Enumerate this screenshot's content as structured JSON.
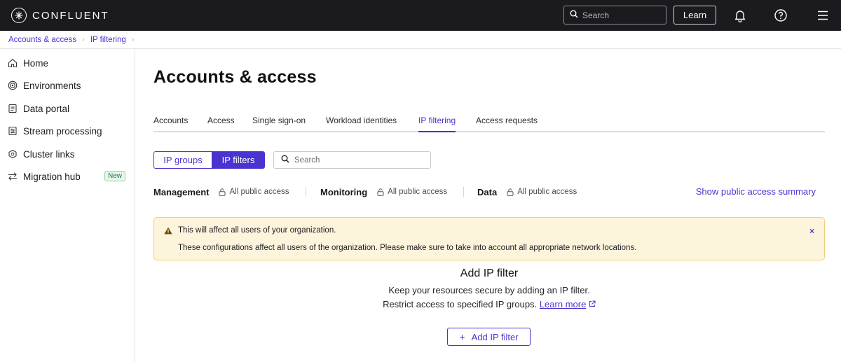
{
  "topbar": {
    "brand": "CONFLUENT",
    "search_placeholder": "Search",
    "learn_label": "Learn",
    "icons": [
      "bell-icon",
      "help-icon",
      "menu-icon"
    ]
  },
  "breadcrumb": [
    "Accounts & access",
    "IP filtering"
  ],
  "sidebar": {
    "items": [
      {
        "label": "Home",
        "icon": "home-icon"
      },
      {
        "label": "Environments",
        "icon": "environments-icon"
      },
      {
        "label": "Data portal",
        "icon": "data-portal-icon"
      },
      {
        "label": "Stream processing",
        "icon": "stream-processing-icon"
      },
      {
        "label": "Cluster links",
        "icon": "cluster-links-icon"
      },
      {
        "label": "Migration hub",
        "icon": "migration-hub-icon",
        "badge": "New"
      }
    ]
  },
  "main": {
    "title": "Accounts & access",
    "tabs": [
      {
        "label": "Accounts",
        "active": false
      },
      {
        "label": "Access",
        "active": false
      },
      {
        "label": "Single sign-on",
        "active": false
      },
      {
        "label": "Workload identities",
        "active": false
      },
      {
        "label": "IP filtering",
        "active": true
      },
      {
        "label": "Access requests",
        "active": false
      }
    ],
    "segments": {
      "left": "IP groups",
      "right": "IP filters",
      "selected": "IP filters"
    },
    "search_placeholder": "Search",
    "access": [
      {
        "label": "Management",
        "value": "All public access"
      },
      {
        "label": "Monitoring",
        "value": "All public access"
      },
      {
        "label": "Data",
        "value": "All public access"
      }
    ],
    "summary_link": "Show public access summary",
    "alert": {
      "title": "This will affect all users of your organization.",
      "body": "These configurations affect all users of the organization. Please make sure to take into account all appropriate network locations.",
      "close": "×"
    },
    "empty": {
      "title": "Add IP filter",
      "line1": "Keep your resources secure by adding an IP filter.",
      "line2": "Restrict access to specified IP groups.",
      "learn_more": "Learn more",
      "button": "Add IP filter",
      "button_icon": "+"
    }
  },
  "colors": {
    "accent": "#4933d1",
    "topbar": "#1b1b1f",
    "alert_bg": "#fdf4dc",
    "alert_border": "#f0cf7c"
  }
}
